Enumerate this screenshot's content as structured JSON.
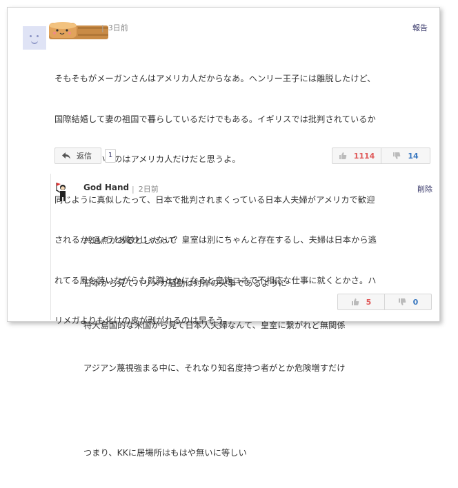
{
  "top_comment": {
    "time": "3日前",
    "report_label": "報告",
    "lines": [
      "そもそもがメーガンさんはアメリカ人だからなあ。ヘンリー王子には離脱したけど、",
      "国際結婚して妻の祖国で暮らしているだけでもある。イギリスでは批判されているか",
      "ら、騙せているのはアメリカ人だけだと思うよ。",
      "同じように真似したって、日本で批判されまくっている日本人夫婦がアメリカで歓迎",
      "されるかというと微妙じゃない？皇室は別にちゃんと存在するし、夫婦は日本から逃",
      "れてる風を装いながらも就職とかになると皇族コネで不相応な仕事に就くとかさ。ハ",
      "リメガよりも化けの皮が剥がれるのは早そう。"
    ],
    "reply_label": "返信",
    "reply_count": "1",
    "upvotes": "1114",
    "downvotes": "14"
  },
  "reply_comment": {
    "author": "God Hand",
    "time": "2日前",
    "delete_label": "削除",
    "lines": [
      "共通点があるとしたって",
      "日本から見てハリメガ騒動は対岸の火事であるように",
      "特大島国的な米国から見て日本人夫婦なんて、皇室に繋がれど無関係",
      "アジアン蔑視強まる中に、それなり知名度持つ者がとか危険増すだけ",
      "",
      "つまり、KKに居場所はもはや無いに等しい"
    ],
    "upvotes": "5",
    "downvotes": "0"
  },
  "colors": {
    "upvote": "#e05a5a",
    "downvote": "#3a78c0"
  },
  "icons": [
    "default-avatar-icon",
    "tape-roll-icon",
    "reply-arrow-icon",
    "thumbs-up-icon",
    "thumbs-down-icon",
    "flag-person-avatar-icon"
  ]
}
